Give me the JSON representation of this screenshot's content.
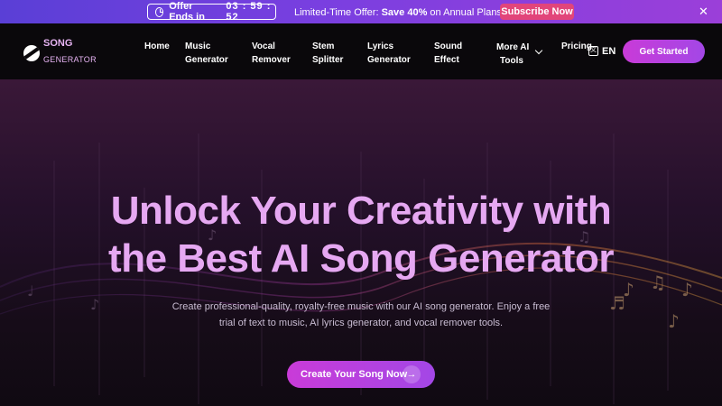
{
  "promo": {
    "timer_label": "Offer Ends in",
    "countdown": "03 : 59 : 52",
    "text_prefix": "Limited-Time Offer:",
    "text_bold": "Save 40%",
    "text_suffix": "on Annual Plans!🎉",
    "subscribe_label": "Subscribe Now",
    "close_label": "✕"
  },
  "nav": {
    "logo_title": "SONG",
    "logo_sub": "GENERATOR",
    "items": [
      {
        "line1": "Home",
        "line2": ""
      },
      {
        "line1": "Music",
        "line2": "Generator"
      },
      {
        "line1": "Vocal",
        "line2": "Remover"
      },
      {
        "line1": "Stem",
        "line2": "Splitter"
      },
      {
        "line1": "Lyrics",
        "line2": "Generator"
      },
      {
        "line1": "Sound",
        "line2": "Effect"
      },
      {
        "line1": "More AI",
        "line2": "Tools"
      },
      {
        "line1": "Pricing",
        "line2": ""
      }
    ],
    "lang": "EN",
    "cta": "Get Started"
  },
  "hero": {
    "headline_1": "Unlock Your Creativity with",
    "headline_2": "the Best AI Song Generator",
    "sub_1": "Create professional-quality, royalty-free music with our AI song generator. Enjoy a free",
    "sub_2": "trial of text to music, AI lyrics generator, and vocal remover tools.",
    "cta": "Create Your Song Now",
    "cta_arrow": "→"
  },
  "colors": {
    "banner": "#7a3fe0",
    "accent": "#c93bd8",
    "headline": "#e6a8f2",
    "subscribe": "#e2457a"
  }
}
